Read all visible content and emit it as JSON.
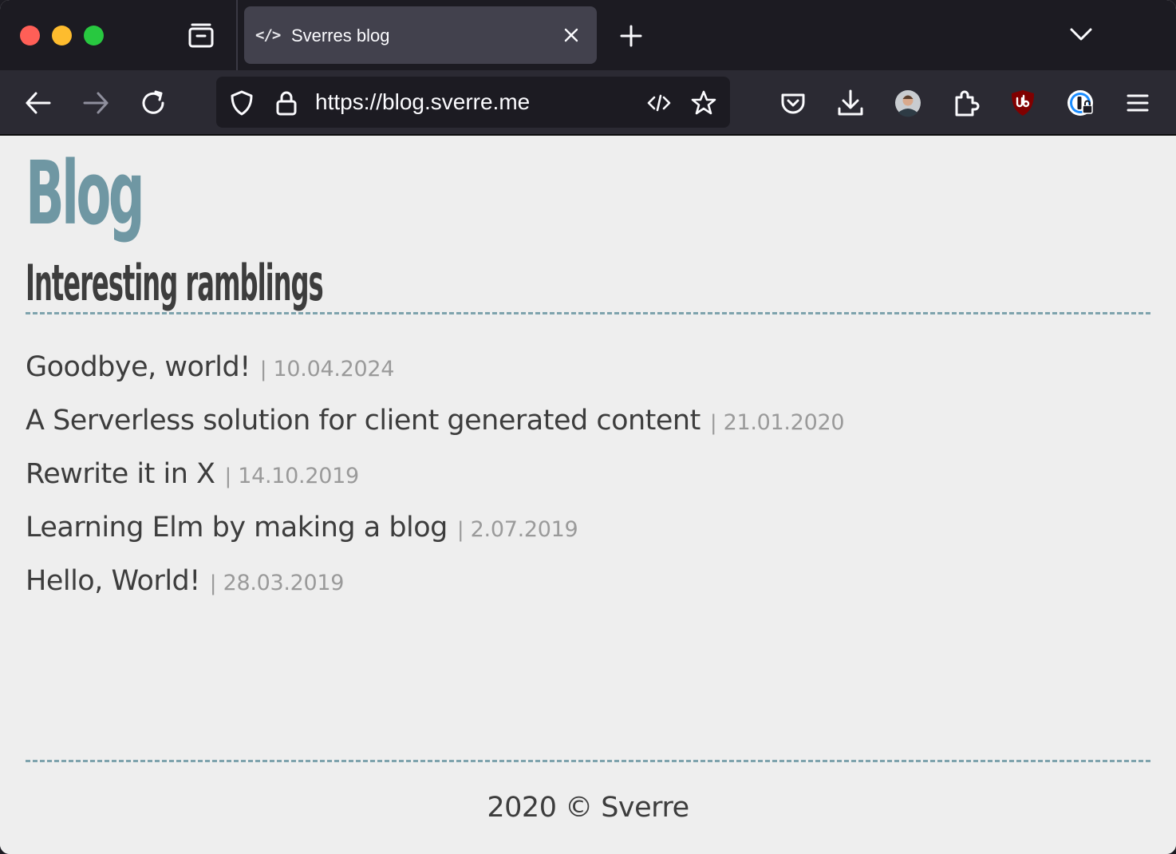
{
  "browser": {
    "tab": {
      "favicon": "</>",
      "title": "Sverres blog"
    },
    "url": "https://blog.sverre.me",
    "icons": {
      "tab_list": "firefox-view-icon",
      "close": "close-icon",
      "new_tab": "plus-icon",
      "list_all_tabs": "chevron-down-icon",
      "back": "arrow-left-icon",
      "forward": "arrow-right-icon",
      "reload": "reload-icon",
      "tracking_protection": "shield-icon",
      "lock": "lock-icon",
      "reader_view": "code-icon",
      "bookmark": "star-icon",
      "pocket": "pocket-icon",
      "downloads": "download-icon",
      "account": "avatar-icon",
      "extensions": "puzzle-icon",
      "ublock": "ublock-origin-icon",
      "password_manager": "1password-icon",
      "menu": "hamburger-menu-icon"
    },
    "colors": {
      "chrome_dark": "#1c1b22",
      "toolbar": "#2b2a33",
      "active_tab": "#42414d"
    }
  },
  "page": {
    "title": "Blog",
    "subtitle": "Interesting ramblings",
    "accent": "#6f97a3",
    "posts": [
      {
        "title": "Goodbye, world!",
        "separator": "|",
        "date": "10.04.2024"
      },
      {
        "title": "A Serverless solution for client generated content",
        "separator": "|",
        "date": "21.01.2020"
      },
      {
        "title": "Rewrite it in X",
        "separator": "|",
        "date": "14.10.2019"
      },
      {
        "title": "Learning Elm by making a blog",
        "separator": "|",
        "date": "2.07.2019"
      },
      {
        "title": "Hello, World!",
        "separator": "|",
        "date": "28.03.2019"
      }
    ],
    "footer": "2020 © Sverre"
  }
}
